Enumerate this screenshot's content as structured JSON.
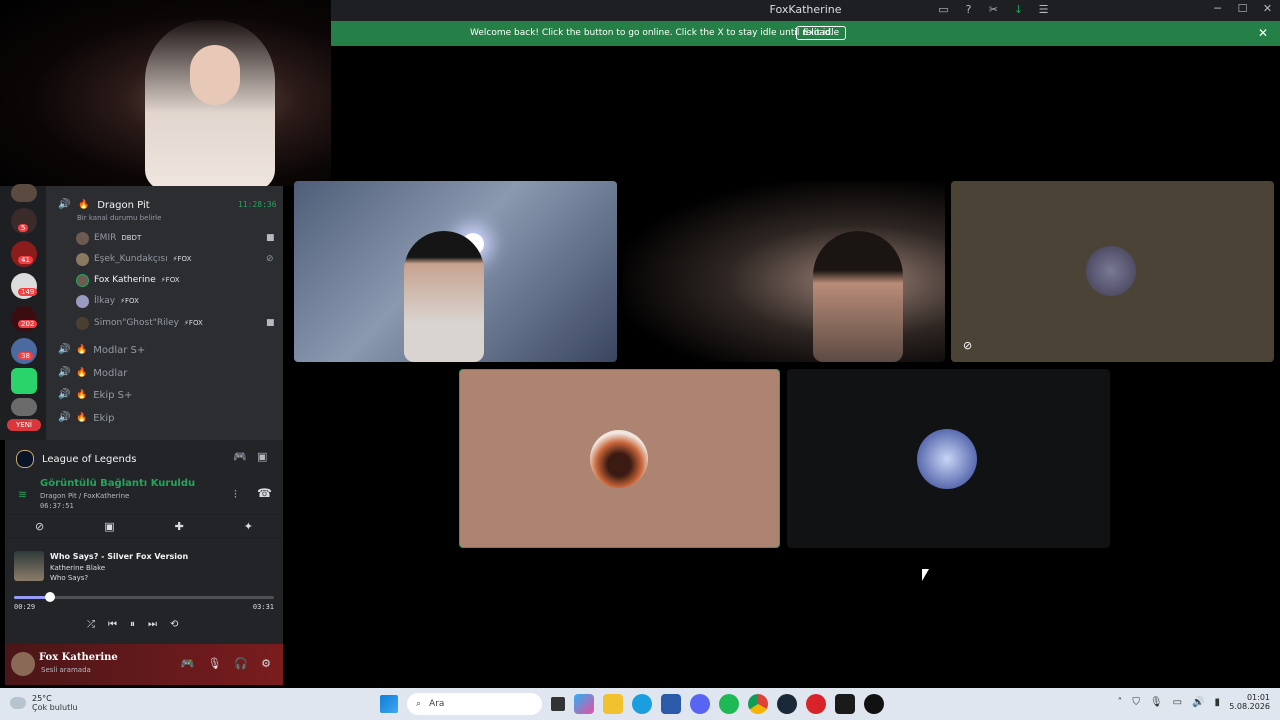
{
  "window": {
    "title": "FoxKatherine",
    "icons": [
      "inbox-icon",
      "help-icon",
      "tools-icon",
      "download-icon",
      "people-icon"
    ],
    "controls": [
      "─",
      "☐",
      "✕"
    ]
  },
  "banner": {
    "message": "Welcome back! Click the button to go online. Click the X to stay idle until reload.",
    "button": "Exit idle",
    "close": "✕"
  },
  "servers": {
    "badges": [
      "5",
      "41",
      "149",
      "202",
      "38"
    ],
    "new_label": "YENİ"
  },
  "voice_channel": {
    "name": "Dragon Pit",
    "timer": "11:28:36",
    "status_hint": "Bir kanal durumu belirle",
    "members": [
      {
        "name": "EMIR",
        "tag": "DBDT"
      },
      {
        "name": "Eşek_Kundakçısı",
        "tag": "⚡FOX"
      },
      {
        "name": "Fox Katherine",
        "tag": "⚡FOX"
      },
      {
        "name": "İlkay",
        "tag": "⚡FOX"
      },
      {
        "name": "Simon\"Ghost\"Riley",
        "tag": "⚡FOX"
      }
    ],
    "other_channels": [
      "Modlar S+",
      "Modlar",
      "Ekip S+",
      "Ekip"
    ]
  },
  "activity": {
    "game": "League of Legends"
  },
  "connection": {
    "status": "Görüntülü Bağlantı Kuruldu",
    "location": "Dragon Pit / FoxKatherine",
    "elapsed": "06:37:51"
  },
  "music": {
    "title": "Who Says? - Silver Fox Version",
    "artist": "Katherine Blake",
    "album": "Who Says?",
    "position": "00:29",
    "duration": "03:31",
    "progress": 0.137
  },
  "user": {
    "name": "Fox Katherine",
    "status": "Sesli aramada"
  },
  "taskbar": {
    "temperature": "25°C",
    "weather": "Çok bulutlu",
    "search_placeholder": "Ara",
    "time": "01:01",
    "date": "5.08.2026"
  },
  "colors": {
    "banner": "#248046",
    "online": "#23a55a",
    "speaking_border": "#23a55a"
  }
}
